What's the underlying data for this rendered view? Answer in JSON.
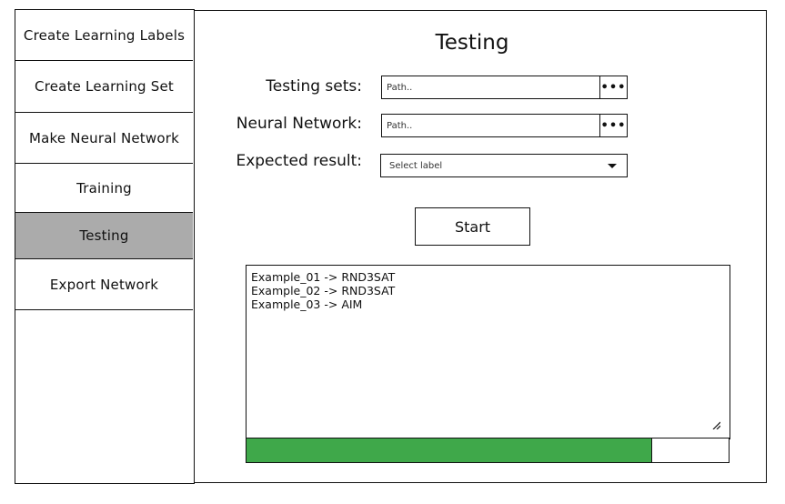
{
  "sidebar": {
    "items": [
      {
        "label": "Create Learning Labels",
        "active": false
      },
      {
        "label": "Create Learning Set",
        "active": false
      },
      {
        "label": "Make Neural Network",
        "active": false
      },
      {
        "label": "Training",
        "active": false
      },
      {
        "label": "Testing",
        "active": true
      },
      {
        "label": "Export Network",
        "active": false
      }
    ]
  },
  "main": {
    "title": "Testing",
    "testing_sets": {
      "label": "Testing sets:",
      "value": "Path..",
      "browse_label": "•••"
    },
    "neural_network": {
      "label": "Neural Network:",
      "value": "Path..",
      "browse_label": "•••"
    },
    "expected_result": {
      "label": "Expected result:",
      "selected": "Select label"
    },
    "start_label": "Start",
    "output": {
      "lines": [
        "Example_01 -> RND3SAT",
        "Example_02 -> RND3SAT",
        "Example_03 -> AIM"
      ]
    },
    "progress": {
      "value": 0.84
    }
  },
  "colors": {
    "active_nav": "#ababab",
    "progress_fill": "#3fa84a",
    "border": "#111111"
  }
}
